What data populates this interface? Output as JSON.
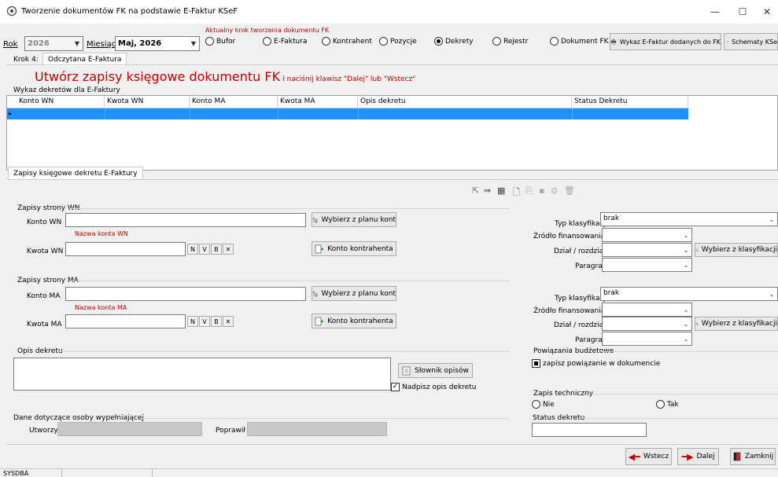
{
  "window": {
    "title": "Tworzenie dokumentów FK na podstawie E-Faktur KSeF",
    "minimize": "—",
    "maximize": "☐",
    "close": "✕"
  },
  "top": {
    "year_label": "Rok",
    "year_value": "2026",
    "month_label": "Miesiąc",
    "month_value": "Maj, 2026",
    "step_caption": "Aktualny krok tworzenia dokumentu FK",
    "steps": [
      "Bufor",
      "E-Faktura",
      "Kontrahent",
      "Pozycje",
      "Dekrety",
      "Rejestr",
      "Dokument FK"
    ],
    "active_step": "Dekrety",
    "btn_list": "Wykaz E-Faktur dodanych do FK",
    "btn_schemas": "Schematy KSe"
  },
  "step": {
    "label": "Krok 4:",
    "tab": "Odczytana E-Faktura",
    "heading": "Utwórz zapisy księgowe dokumentu FK",
    "hint": "i naciśnij klawisz \"Dalej\" lub \"Wstecz\""
  },
  "grid": {
    "caption": "Wykaz dekretów dla E-Faktury",
    "columns": [
      "Konto WN",
      "Kwota WN",
      "Konto MA",
      "Kwota MA",
      "Opis dekretu",
      "Status Dekretu"
    ]
  },
  "subtab": "Zapisy księgowe dekretu E-Faktury",
  "wn": {
    "group": "Zapisy strony WN",
    "konto_label": "Konto WN",
    "konto_value": "",
    "nazwa": "Nazwa konta WN",
    "kwota_label": "Kwota WN",
    "kwota_value": "",
    "btn_plan": "Wybierz z planu kont",
    "btn_kontr": "Konto kontrahenta",
    "typ_label": "Typ klasyfikacji",
    "typ_value": "brak",
    "zrodlo_label": "Źródło finansowania",
    "dzial_label": "Dział / rozdział",
    "paragraf_label": "Paragraf",
    "btn_klas": "Wybierz z klasyfikacji"
  },
  "ma": {
    "group": "Zapisy strony MA",
    "konto_label": "Konto MA",
    "konto_value": "",
    "nazwa": "Nazwa konta MA",
    "kwota_label": "Kwota MA",
    "kwota_value": "",
    "btn_plan": "Wybierz z planu kont",
    "btn_kontr": "Konto kontrahenta",
    "typ_label": "Typ klasyfikacji",
    "typ_value": "brak",
    "zrodlo_label": "Źródło finansowania",
    "dzial_label": "Dział / rozdział",
    "paragraf_label": "Paragraf",
    "btn_klas": "Wybierz z klasyfikacji"
  },
  "nvb": [
    "N",
    "V",
    "B",
    "✕"
  ],
  "opis": {
    "group": "Opis dekretu",
    "btn_slownik": "Słownik opisów",
    "chk_nadpisz": "Nadpisz opis dekretu"
  },
  "powiazania": {
    "group": "Powiązania budżetowe",
    "chk": "zapisz powiązanie w dokumencie"
  },
  "techniczny": {
    "group": "Zapis techniczny",
    "nie": "Nie",
    "tak": "Tak"
  },
  "osoba": {
    "group": "Dane dotyczące osoby wypełniającej",
    "utworzyl": "Utworzył",
    "poprawil": "Poprawił"
  },
  "status": {
    "group": "Status dekretu"
  },
  "footer": {
    "wstecz": "Wstecz",
    "dalej": "Dalej",
    "zamknij": "Zamknij"
  },
  "statusbar": {
    "user": "SYSDBA"
  },
  "colors": {
    "accent_red": "#c00000",
    "selected_row": "#1e90ff"
  }
}
